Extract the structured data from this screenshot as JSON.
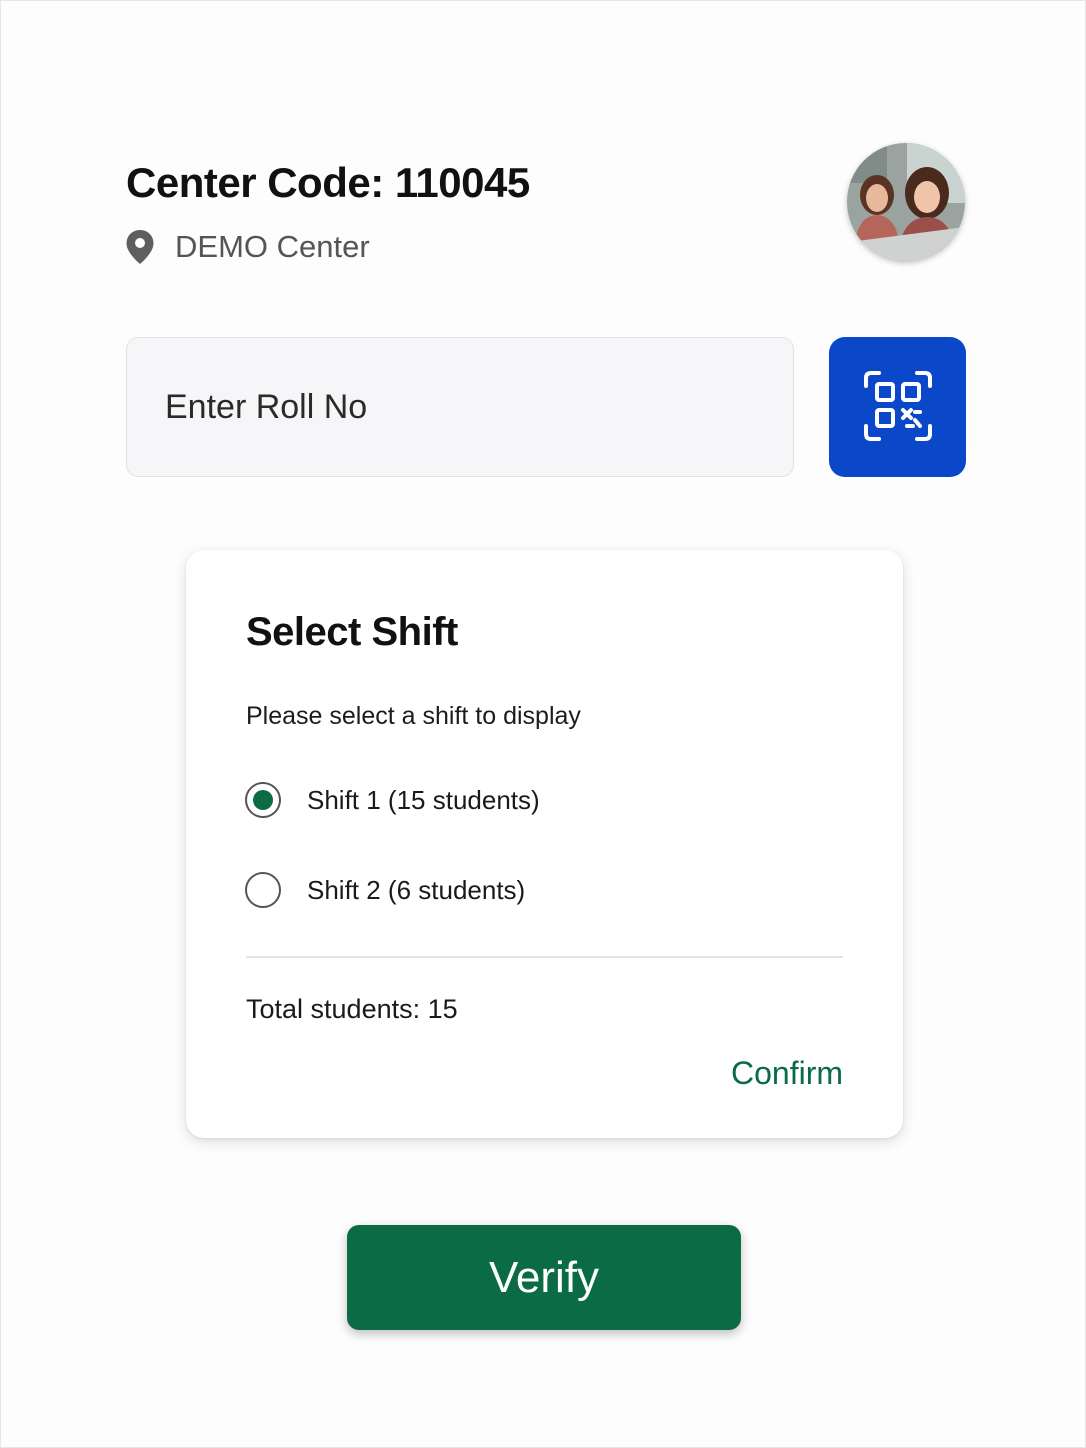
{
  "header": {
    "title": "Center Code: 110045",
    "location_icon": "location-pin-icon",
    "location": "DEMO Center"
  },
  "avatar": {
    "icon": "profile-photo"
  },
  "roll_input": {
    "placeholder": "Enter Roll No",
    "value": ""
  },
  "scan_button": {
    "icon": "qr-scan-icon",
    "color": "#0a47c9"
  },
  "shift_dialog": {
    "title": "Select Shift",
    "subtitle": "Please select a shift to display",
    "options": [
      {
        "label": "Shift 1 (15 students)",
        "selected": true
      },
      {
        "label": "Shift 2 (6 students)",
        "selected": false
      }
    ],
    "total": "Total students: 15",
    "confirm_label": "Confirm"
  },
  "verify_button": {
    "label": "Verify",
    "color": "#0b6b45"
  }
}
